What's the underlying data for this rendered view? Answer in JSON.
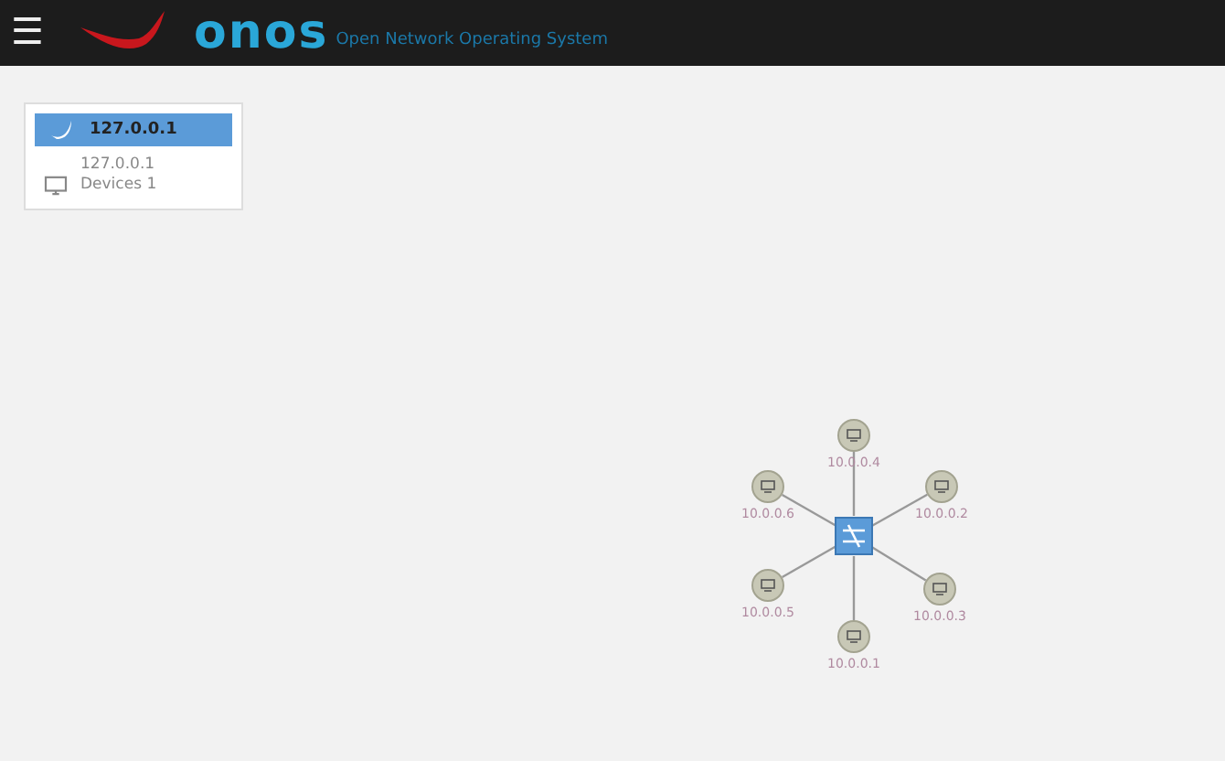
{
  "header": {
    "menu_glyph": "☰",
    "logo": "onos",
    "tagline": "Open Network Operating System"
  },
  "summary": {
    "title": "127.0.0.1",
    "ip": "127.0.0.1",
    "devices": "Devices 1"
  },
  "topology": {
    "hosts": [
      {
        "label": "10.0.0.4"
      },
      {
        "label": "10.0.0.2"
      },
      {
        "label": "10.0.0.3"
      },
      {
        "label": "10.0.0.1"
      },
      {
        "label": "10.0.0.5"
      },
      {
        "label": "10.0.0.6"
      }
    ]
  }
}
